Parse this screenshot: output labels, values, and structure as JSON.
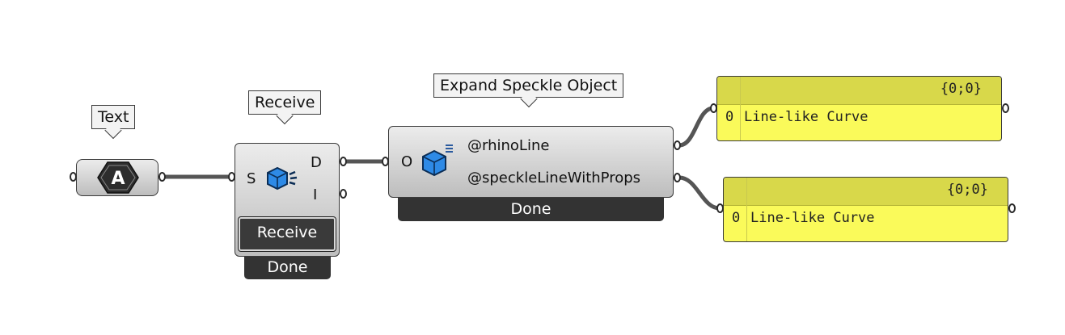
{
  "text_component": {
    "callout": "Text",
    "icon_letter": "A"
  },
  "receive_component": {
    "callout": "Receive",
    "input_label": "S",
    "output_labels": [
      "D",
      "I"
    ],
    "button_label": "Receive",
    "status": "Done"
  },
  "expand_component": {
    "callout": "Expand Speckle Object",
    "input_label": "O",
    "output_labels": [
      "@rhinoLine",
      "@speckleLineWithProps"
    ],
    "status": "Done"
  },
  "panels": [
    {
      "path": "{0;0}",
      "index": "0",
      "value": "Line-like Curve"
    },
    {
      "path": "{0;0}",
      "index": "0",
      "value": "Line-like Curve"
    }
  ],
  "colors": {
    "panel_fill": "#fafa5a",
    "panel_header": "#d8d84a",
    "status_bg": "#333333",
    "speckle_blue": "#2e8ae6"
  }
}
